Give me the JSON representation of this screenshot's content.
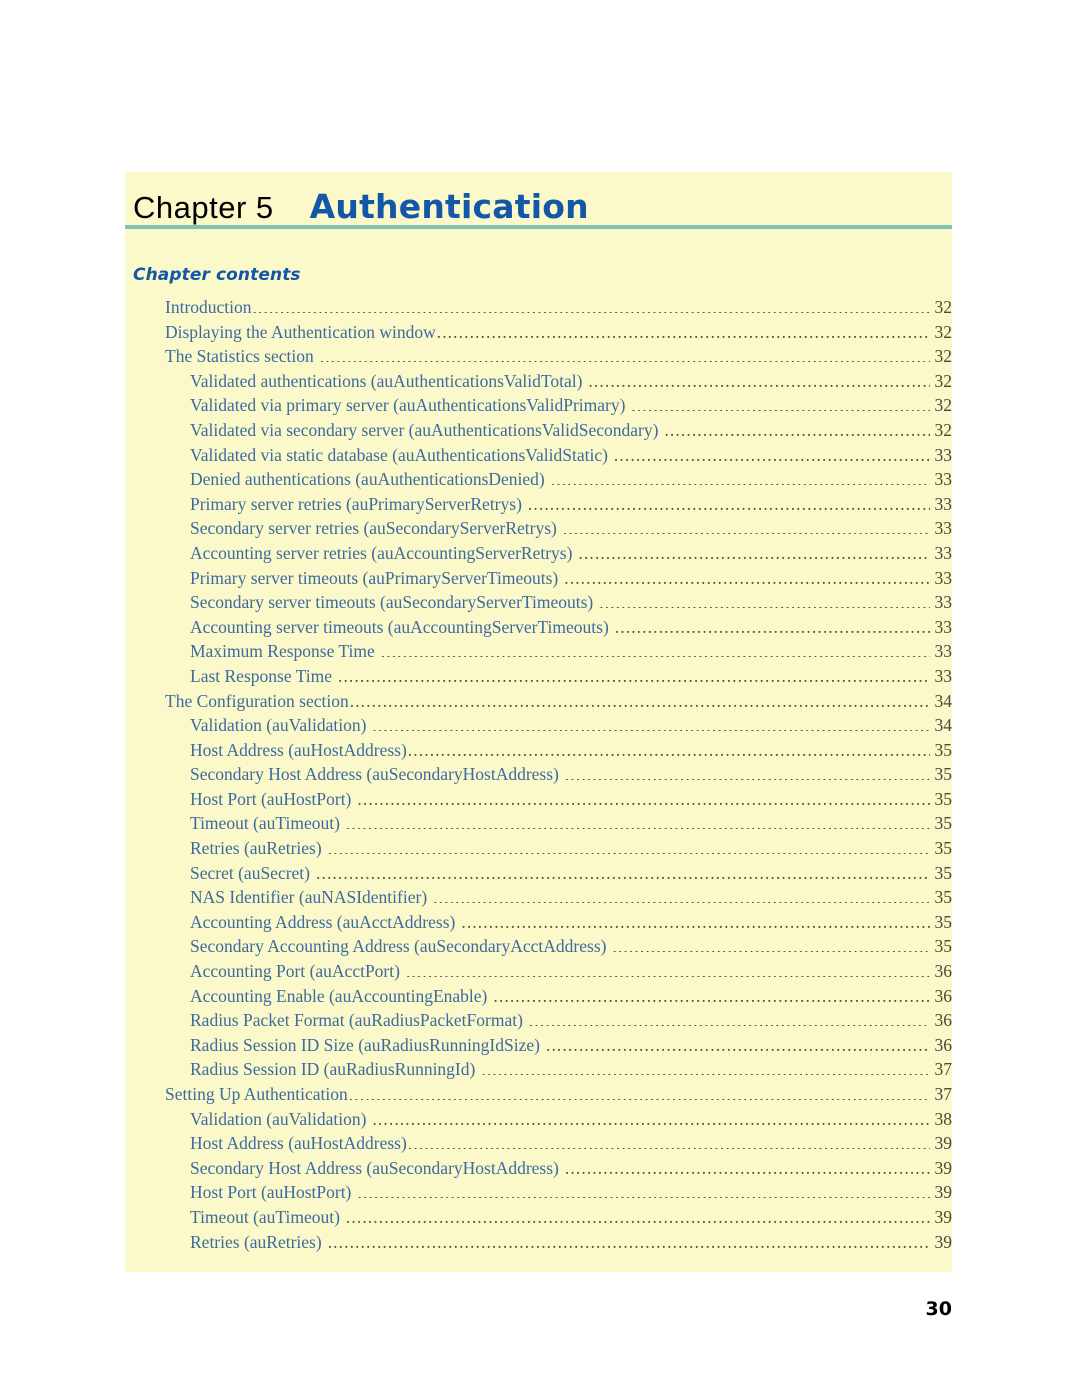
{
  "document": {
    "chapter_label": "Chapter 5",
    "chapter_title": "Authentication",
    "contents_heading": "Chapter contents",
    "folio": "30",
    "accent_blue": "#1257a8",
    "rule_teal": "#7cc3b4",
    "panel_cream": "#fbf8ca",
    "toc_text_blue": "#3c6b9e"
  },
  "toc": [
    {
      "label": "Introduction",
      "page": "32",
      "level": 1,
      "gap": false
    },
    {
      "label": "Displaying the Authentication window",
      "page": "32",
      "level": 1,
      "gap": false
    },
    {
      "label": "The Statistics section",
      "page": "32",
      "level": 1,
      "gap": true
    },
    {
      "label": "Validated authentications (auAuthenticationsValidTotal)",
      "page": "32",
      "level": 2,
      "gap": true
    },
    {
      "label": "Validated via primary server (auAuthenticationsValidPrimary)",
      "page": "32",
      "level": 2,
      "gap": true
    },
    {
      "label": "Validated via secondary server (auAuthenticationsValidSecondary)",
      "page": "32",
      "level": 2,
      "gap": true
    },
    {
      "label": "Validated via static database (auAuthenticationsValidStatic)",
      "page": "33",
      "level": 2,
      "gap": true
    },
    {
      "label": "Denied authentications (auAuthenticationsDenied)",
      "page": "33",
      "level": 2,
      "gap": true
    },
    {
      "label": "Primary server retries (auPrimaryServerRetrys)",
      "page": "33",
      "level": 2,
      "gap": true
    },
    {
      "label": "Secondary server retries (auSecondaryServerRetrys)",
      "page": "33",
      "level": 2,
      "gap": true
    },
    {
      "label": "Accounting server retries (auAccountingServerRetrys)",
      "page": "33",
      "level": 2,
      "gap": true
    },
    {
      "label": "Primary server timeouts (auPrimaryServerTimeouts)",
      "page": "33",
      "level": 2,
      "gap": true
    },
    {
      "label": "Secondary server timeouts (auSecondaryServerTimeouts)",
      "page": "33",
      "level": 2,
      "gap": true
    },
    {
      "label": "Accounting server timeouts (auAccountingServerTimeouts)",
      "page": "33",
      "level": 2,
      "gap": true
    },
    {
      "label": "Maximum Response Time",
      "page": "33",
      "level": 2,
      "gap": true
    },
    {
      "label": "Last Response Time",
      "page": "33",
      "level": 2,
      "gap": true
    },
    {
      "label": "The Configuration section",
      "page": "34",
      "level": 1,
      "gap": false
    },
    {
      "label": "Validation (auValidation)",
      "page": "34",
      "level": 2,
      "gap": true
    },
    {
      "label": "Host Address (auHostAddress)",
      "page": "35",
      "level": 2,
      "gap": false
    },
    {
      "label": "Secondary Host Address (auSecondaryHostAddress)",
      "page": "35",
      "level": 2,
      "gap": true
    },
    {
      "label": "Host Port (auHostPort)",
      "page": "35",
      "level": 2,
      "gap": true
    },
    {
      "label": "Timeout (auTimeout)",
      "page": "35",
      "level": 2,
      "gap": true
    },
    {
      "label": "Retries (auRetries)",
      "page": "35",
      "level": 2,
      "gap": true
    },
    {
      "label": "Secret (auSecret)",
      "page": "35",
      "level": 2,
      "gap": true
    },
    {
      "label": "NAS Identifier (auNASIdentifier)",
      "page": "35",
      "level": 2,
      "gap": true
    },
    {
      "label": "Accounting Address (auAcctAddress)",
      "page": "35",
      "level": 2,
      "gap": true
    },
    {
      "label": "Secondary Accounting Address (auSecondaryAcctAddress)",
      "page": "35",
      "level": 2,
      "gap": true
    },
    {
      "label": "Accounting Port (auAcctPort)",
      "page": "36",
      "level": 2,
      "gap": true
    },
    {
      "label": "Accounting Enable (auAccountingEnable)",
      "page": "36",
      "level": 2,
      "gap": true
    },
    {
      "label": "Radius Packet Format (auRadiusPacketFormat)",
      "page": "36",
      "level": 2,
      "gap": true
    },
    {
      "label": "Radius Session ID Size (auRadiusRunningIdSize)",
      "page": "36",
      "level": 2,
      "gap": true
    },
    {
      "label": "Radius Session ID (auRadiusRunningId)",
      "page": "37",
      "level": 2,
      "gap": true
    },
    {
      "label": "Setting Up Authentication",
      "page": "37",
      "level": 1,
      "gap": false
    },
    {
      "label": "Validation (auValidation)",
      "page": "38",
      "level": 2,
      "gap": true
    },
    {
      "label": "Host Address (auHostAddress)",
      "page": "39",
      "level": 2,
      "gap": false
    },
    {
      "label": "Secondary Host Address (auSecondaryHostAddress)",
      "page": "39",
      "level": 2,
      "gap": true
    },
    {
      "label": "Host Port (auHostPort)",
      "page": "39",
      "level": 2,
      "gap": true
    },
    {
      "label": "Timeout (auTimeout)",
      "page": "39",
      "level": 2,
      "gap": true
    },
    {
      "label": "Retries (auRetries)",
      "page": "39",
      "level": 2,
      "gap": true
    }
  ]
}
